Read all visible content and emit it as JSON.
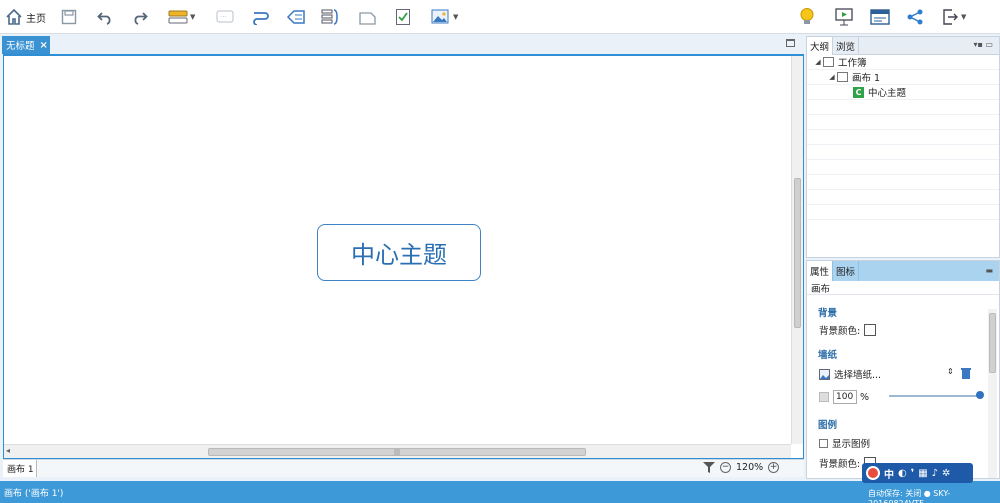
{
  "toolbar": {
    "home_label": "主页"
  },
  "document_tab": {
    "title": "无标题",
    "close": "×"
  },
  "canvas": {
    "central_topic": "中心主题"
  },
  "sheet_bar": {
    "sheet_name": "画布 1",
    "zoom_minus": "−",
    "zoom_level": "120%",
    "zoom_plus": "+"
  },
  "status_bar": {
    "left_text": "画布 ('画布 1')",
    "right_text": "自动保存: 关闭 ● SKY-20160824VTF"
  },
  "outline_panel": {
    "tabs": [
      "大纲",
      "浏览"
    ],
    "tree": [
      {
        "label": "工作簿",
        "level": 0
      },
      {
        "label": "画布 1",
        "level": 1
      },
      {
        "label": "中心主题",
        "level": 2
      }
    ]
  },
  "properties_panel": {
    "tabs": [
      "属性",
      "图标"
    ],
    "title": "画布",
    "background_section": "背景",
    "background_color_label": "背景颜色:",
    "wallpaper_section": "墙纸",
    "select_wallpaper": "选择墙纸...",
    "opacity_value": "100",
    "opacity_unit": "%",
    "partial_section_label": "图例",
    "partial_checkbox_label": "显示图例",
    "partial_bg_color_label": "背景颜色:"
  },
  "ime_bar": {
    "label": "中"
  },
  "colors": {
    "accent": "#3a92d2",
    "status_bar": "#3d99d8",
    "topic_border": "#3d83c6",
    "topic_text": "#2b6fb3"
  }
}
